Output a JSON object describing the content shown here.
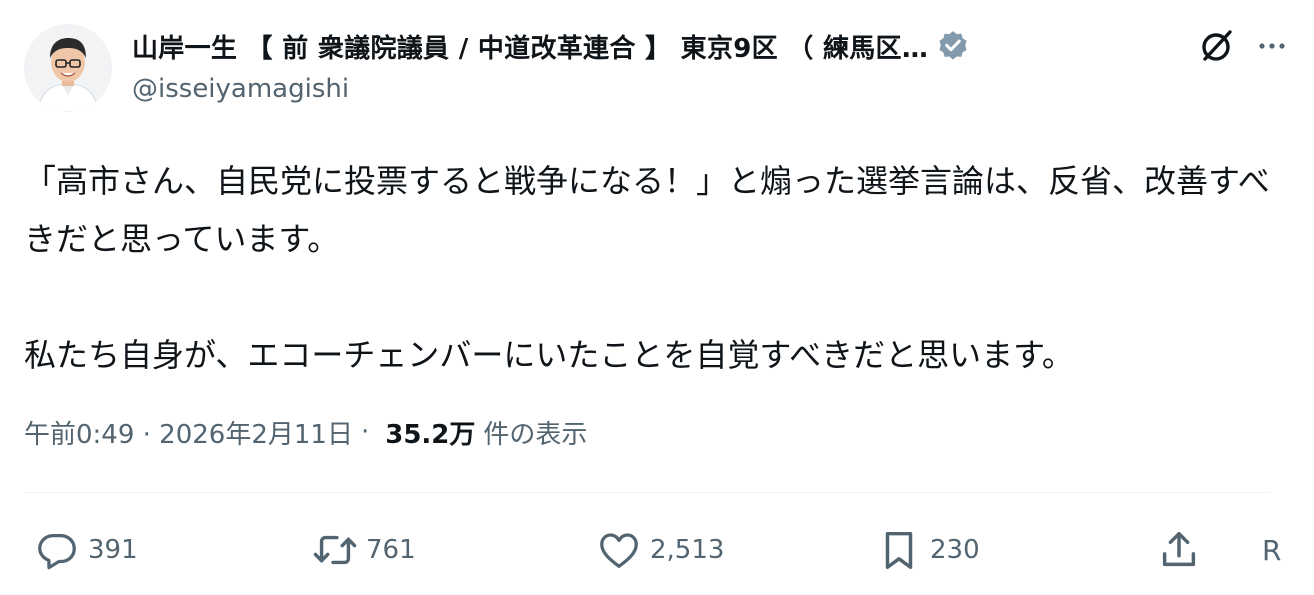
{
  "author": {
    "display_name": "山岸一生 【 前 衆議院議員 / 中道改革連合 】 東京9区 （ 練馬区…",
    "handle": "@isseiyamagishi"
  },
  "icons": {
    "verified": "verified-badge-icon",
    "grok": "grok-icon",
    "more": "more-icon",
    "reply": "reply-icon",
    "retweet": "retweet-icon",
    "like": "heart-icon",
    "bookmark": "bookmark-icon",
    "share": "share-icon"
  },
  "colors": {
    "text": "#0f1419",
    "secondary": "#536471",
    "verified": "#829aab",
    "divider": "#eff3f4"
  },
  "tweet": {
    "text": "「高市さん、自民党に投票すると戦争になる！」と煽った選挙言論は、反省、改善すべきだと思っています。\n\n私たち自身が、エコーチェンバーにいたことを自覚すべきだと思います。",
    "time": "午前0:49 · 2026年2月11日",
    "separator": "·",
    "views_count": "35.2万",
    "views_label": "件の表示"
  },
  "actions": {
    "reply_count": "391",
    "retweet_count": "761",
    "like_count": "2,513",
    "bookmark_count": "230",
    "extra_label": "R"
  }
}
